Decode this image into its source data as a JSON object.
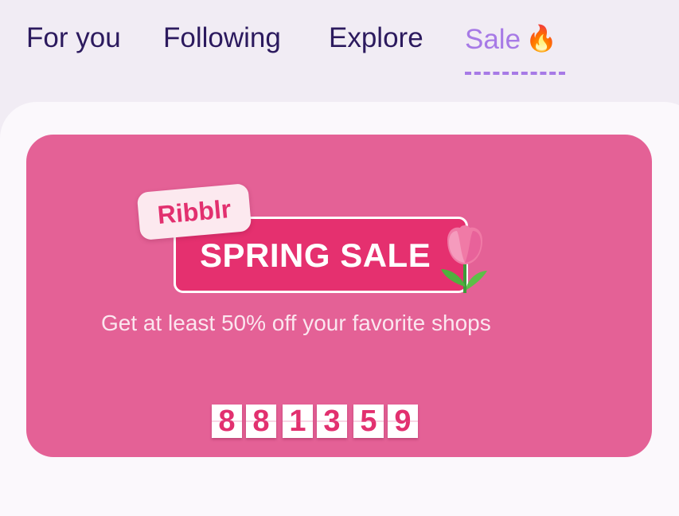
{
  "tabs": [
    {
      "label": "For you",
      "active": false
    },
    {
      "label": "Following",
      "active": false
    },
    {
      "label": "Explore",
      "active": false
    },
    {
      "label": "Sale",
      "emoji": "🔥",
      "active": true
    }
  ],
  "banner": {
    "brand": "Ribblr",
    "title": "SPRING SALE",
    "title_icon": "tulip-icon",
    "subtitle": "Get at least 50% off your favorite shops",
    "countdown": [
      "8",
      "8",
      "1",
      "3",
      "5",
      "9"
    ]
  },
  "colors": {
    "accent": "#a77ae6",
    "tab_text": "#2c1a5e",
    "banner_bg": "#e46196",
    "sale_pink": "#e5306f"
  }
}
